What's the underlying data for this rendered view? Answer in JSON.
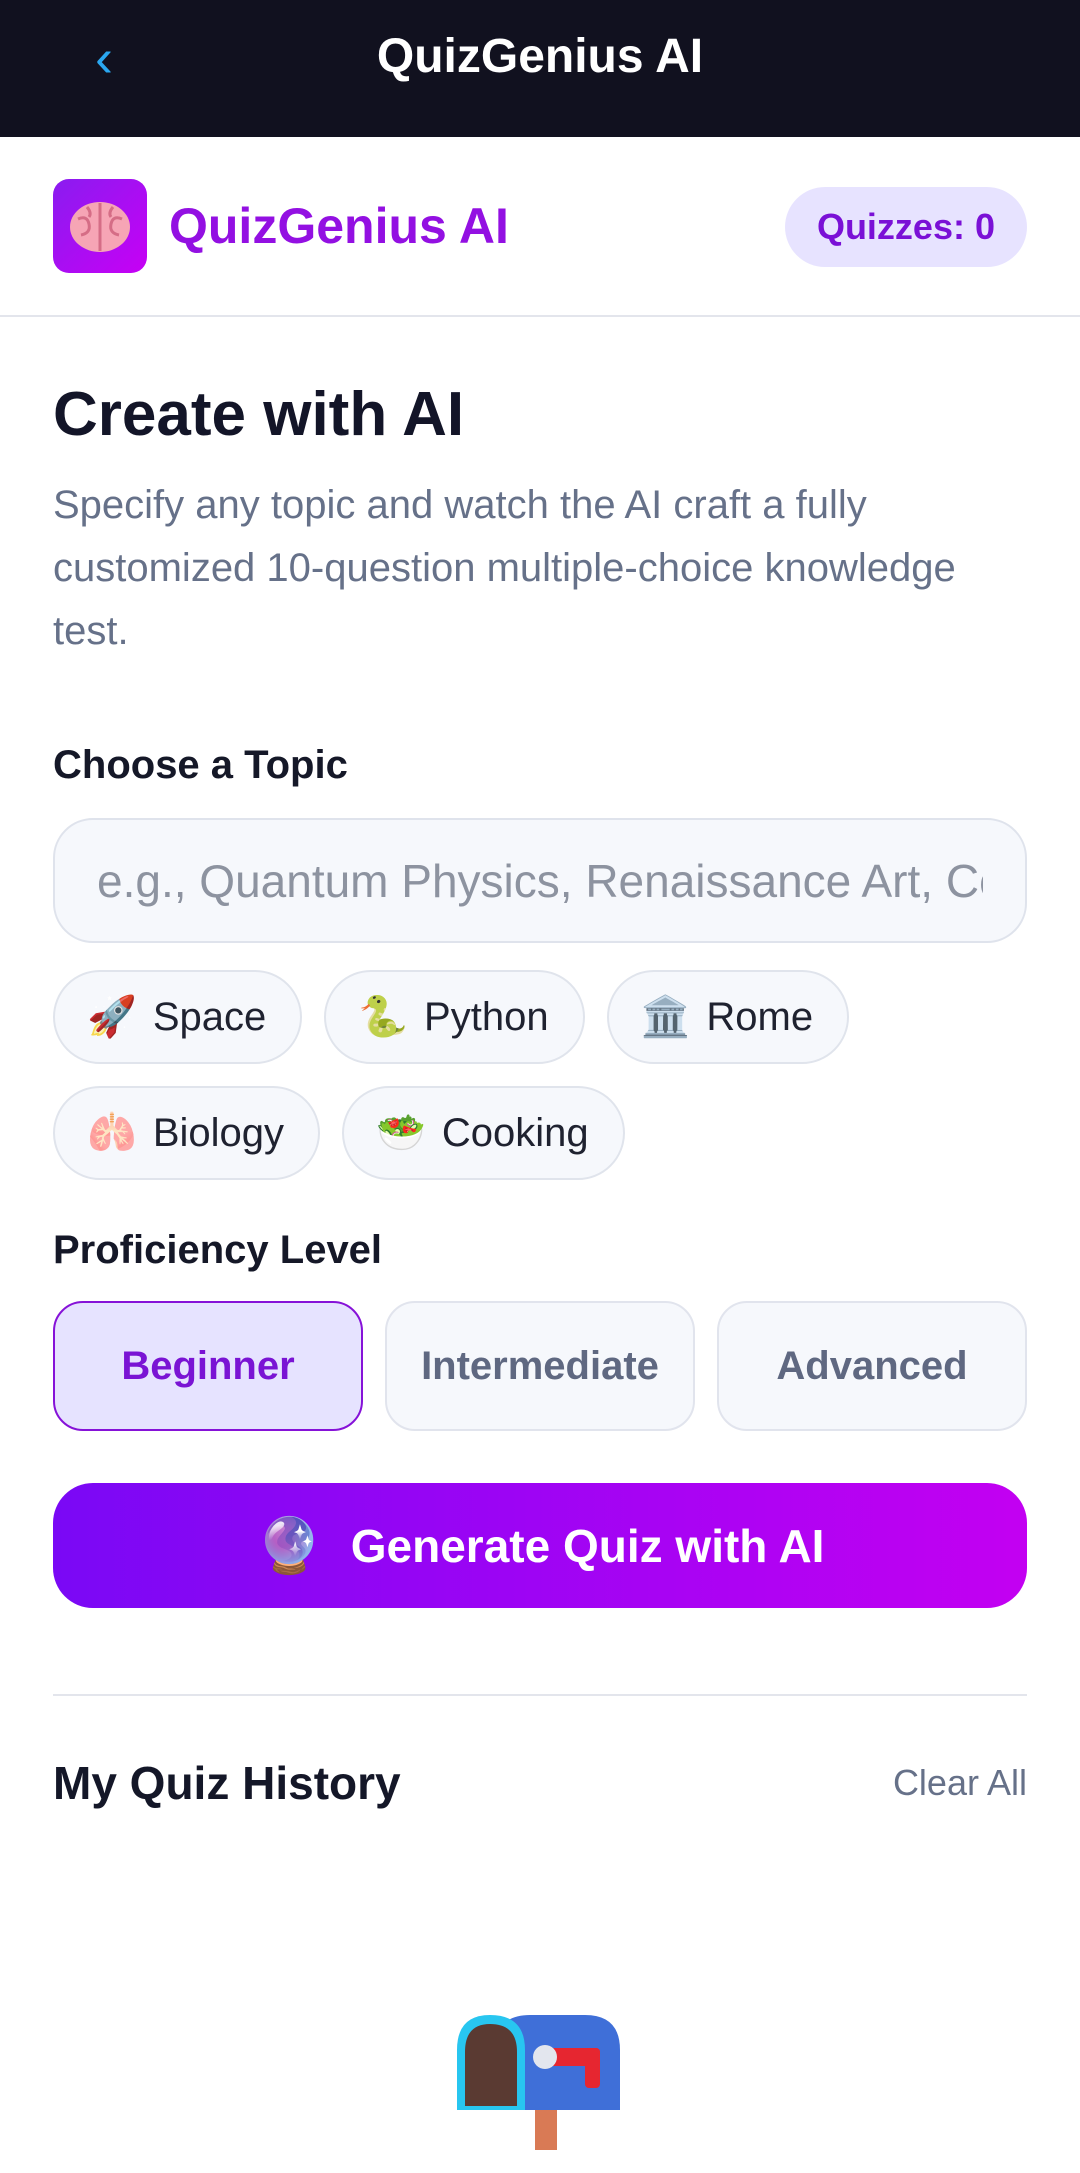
{
  "app_bar": {
    "title": "QuizGenius AI",
    "back_icon": "chevron-left-icon"
  },
  "header": {
    "logo_icon": "brain-icon",
    "brand": "QuizGenius AI",
    "quiz_count": "Quizzes: 0"
  },
  "create": {
    "title": "Create with AI",
    "description": "Specify any topic and watch the AI craft a fully customized 10-question multiple-choice knowledge test."
  },
  "topic": {
    "label": "Choose a Topic",
    "placeholder": "e.g., Quantum Physics, Renaissance Art, Cooking",
    "value": "",
    "chips": [
      {
        "icon": "🚀",
        "label": "Space"
      },
      {
        "icon": "🐍",
        "label": "Python"
      },
      {
        "icon": "🏛️",
        "label": "Rome"
      },
      {
        "icon": "🫁",
        "label": "Biology"
      },
      {
        "icon": "🥗",
        "label": "Cooking"
      }
    ]
  },
  "proficiency": {
    "label": "Proficiency Level",
    "levels": [
      "Beginner",
      "Intermediate",
      "Advanced"
    ],
    "selected": "Beginner"
  },
  "generate": {
    "icon": "🔮",
    "label": "Generate Quiz with AI"
  },
  "history": {
    "title": "My Quiz History",
    "clear_label": "Clear All",
    "empty_icon": "mailbox-icon"
  },
  "colors": {
    "accent": "#9310e2",
    "topbar": "#11111f",
    "selected_level_bg": "#e6e3ff",
    "button_gradient_start": "#7a08f5",
    "button_gradient_end": "#c300f2"
  }
}
